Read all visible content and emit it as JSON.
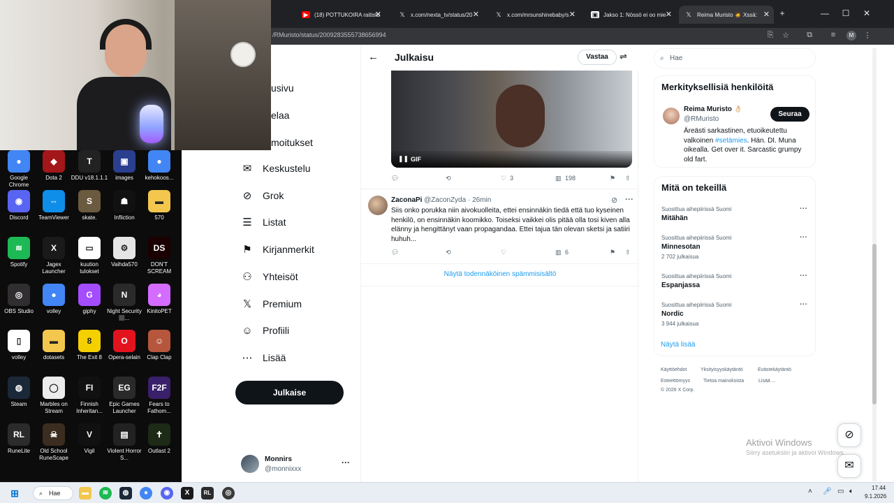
{
  "desktop": {
    "icons": [
      {
        "label": "Google Chrome",
        "color": "#4285f4",
        "glyph": "●"
      },
      {
        "label": "Dota 2",
        "color": "#a3161a",
        "glyph": "◆"
      },
      {
        "label": "DDU v18.1.1.1",
        "color": "#222",
        "glyph": "T"
      },
      {
        "label": "images",
        "color": "#2b3f8f",
        "glyph": "▣"
      },
      {
        "label": "kehokoos...",
        "color": "#4285f4",
        "glyph": "●"
      },
      {
        "label": "Discord",
        "color": "#5865f2",
        "glyph": "◉"
      },
      {
        "label": "TeamViewer",
        "color": "#0e8ee9",
        "glyph": "⇔"
      },
      {
        "label": "skate.",
        "color": "#6a5a3f",
        "glyph": "S"
      },
      {
        "label": "Infliction",
        "color": "#111",
        "glyph": "☗"
      },
      {
        "label": "570",
        "color": "#f3c74d",
        "glyph": "▬"
      },
      {
        "label": "Spotify",
        "color": "#1db954",
        "glyph": "≋"
      },
      {
        "label": "Jagex Launcher",
        "color": "#1a1a1a",
        "glyph": "X"
      },
      {
        "label": "kuution tulokset",
        "color": "#ffffff",
        "glyph": "▭"
      },
      {
        "label": "Vaihda570",
        "color": "#e5e5e5",
        "glyph": "⚙"
      },
      {
        "label": "DON'T SCREAM",
        "color": "#1a0000",
        "glyph": "DS"
      },
      {
        "label": "OBS Studio",
        "color": "#302e31",
        "glyph": "◎"
      },
      {
        "label": "volley",
        "color": "#4285f4",
        "glyph": "●"
      },
      {
        "label": "giphy",
        "color": "#a44dff",
        "glyph": "G"
      },
      {
        "label": "Night Security 🏽...",
        "color": "#2a2a2a",
        "glyph": "N"
      },
      {
        "label": "KinitoPET",
        "color": "#d46cff",
        "glyph": "◕"
      },
      {
        "label": "volley",
        "color": "#ffffff",
        "glyph": "▯"
      },
      {
        "label": "dotasets",
        "color": "#f3c74d",
        "glyph": "▬"
      },
      {
        "label": "The Exit 8",
        "color": "#f5d000",
        "glyph": "8"
      },
      {
        "label": "Opera-selain",
        "color": "#e3131e",
        "glyph": "O"
      },
      {
        "label": "Clap Clap",
        "color": "#b6563c",
        "glyph": "☺"
      },
      {
        "label": "Steam",
        "color": "#1b2838",
        "glyph": "◍"
      },
      {
        "label": "Marbles on Stream",
        "color": "#ececec",
        "glyph": "◯"
      },
      {
        "label": "Finnish Inheritan...",
        "color": "#111",
        "glyph": "FI"
      },
      {
        "label": "Epic Games Launcher",
        "color": "#2a2a2a",
        "glyph": "EG"
      },
      {
        "label": "Fears to Fathom...",
        "color": "#3a1f6a",
        "glyph": "F2F"
      },
      {
        "label": "RuneLite",
        "color": "#2b2b2b",
        "glyph": "RL"
      },
      {
        "label": "Old School RuneScape",
        "color": "#3b2d1f",
        "glyph": "☠"
      },
      {
        "label": "Vigil",
        "color": "#111",
        "glyph": "V"
      },
      {
        "label": "Violent Horror S...",
        "color": "#222",
        "glyph": "▤"
      },
      {
        "label": "Outlast 2",
        "color": "#1c2a16",
        "glyph": "✝"
      }
    ]
  },
  "browser": {
    "tabs": [
      {
        "label": "(18) POTTUKOIRA raitistu",
        "fav": "▶",
        "favcolor": "#ff0000"
      },
      {
        "label": "x.com/nexta_tv/status/20",
        "fav": "X",
        "favcolor": "#202124"
      },
      {
        "label": "x.com/mrsunshinebaby/s",
        "fav": "X",
        "favcolor": "#202124"
      },
      {
        "label": "Jakso 1: Nössö ei oo mie",
        "fav": "▣",
        "favcolor": "#ffffff"
      },
      {
        "label": "Reima Muristo 🧔 Xssä:",
        "fav": "X",
        "favcolor": "#202124"
      }
    ],
    "new_tab": "+",
    "url": "/RMuristo/status/2009283555738656994",
    "profile_letter": "M"
  },
  "x": {
    "nav": [
      {
        "label": "Etusivu",
        "icon": "⌂"
      },
      {
        "label": "Selaa",
        "icon": "⌕"
      },
      {
        "label": "Ilmoitukset",
        "icon": "🔔"
      },
      {
        "label": "Keskustelu",
        "icon": "✉"
      },
      {
        "label": "Grok",
        "icon": "⊘"
      },
      {
        "label": "Listat",
        "icon": "☰"
      },
      {
        "label": "Kirjanmerkit",
        "icon": "⚑"
      },
      {
        "label": "Yhteisöt",
        "icon": "⚇"
      },
      {
        "label": "Premium",
        "icon": "𝕏"
      },
      {
        "label": "Profiili",
        "icon": "☺"
      },
      {
        "label": "Lisää",
        "icon": "⋯"
      }
    ],
    "visible_nav": [
      "usivu",
      "elaa",
      "moitukset"
    ],
    "post_button": "Julkaise",
    "account": {
      "name": "Monnirs",
      "handle": "@monnixxx",
      "more": "···"
    },
    "header": {
      "title": "Julkaisu",
      "reply": "Vastaa"
    },
    "gif_label": "GIF",
    "tweet1_actions": {
      "likes": "3",
      "views": "198"
    },
    "tweet2": {
      "name": "ZaconaPi",
      "handle": "@ZaconZyda · 26min",
      "text": "Siis onko porukka niin aivokuolleita, ettei ensinnäkin tiedä että tuo kyseinen henkilö, on ensinnäkin koomikko. Toiseksi vaikkei olis pitää olla tosi kiven alla elänny ja hengittänyt vaan propagandaa. Ettei tajua tän olevan sketsi ja satiiri huhuh...",
      "views": "6"
    },
    "spam_link": "Näytä todennäköinen spämmisisältö",
    "search_placeholder": "Hae",
    "relevant": {
      "title": "Merkityksellisiä henkilöitä",
      "name": "Reima Muristo 👌🏻",
      "handle": "@RMuristo",
      "follow": "Seuraa",
      "bio_a": "Äreästi sarkastinen, etuoikeutettu valkoinen ",
      "bio_tag": "#setämies",
      "bio_b": ". Hän. DI. Muna oikealla. Get over it. Sarcastic grumpy old fart."
    },
    "trends": {
      "title": "Mitä on tekeillä",
      "items": [
        {
          "meta": "Suosittua aihepiirissä Suomi",
          "name": "Mitähän",
          "count": ""
        },
        {
          "meta": "Suosittua aihepiirissä Suomi",
          "name": "Minnesotan",
          "count": "2 702 julkaisua"
        },
        {
          "meta": "Suosittua aihepiirissä Suomi",
          "name": "Espanjassa",
          "count": ""
        },
        {
          "meta": "Suosittua aihepiirissä Suomi",
          "name": "Nordic",
          "count": "3 944 julkaisua"
        }
      ],
      "show_more": "Näytä lisää"
    },
    "footer": {
      "l1": "Käyttöehdot",
      "l2": "Yksityisyyskäytäntö",
      "l3": "Evästekäytäntö",
      "l4": "Esteettömyys",
      "l5": "Tietoa mainoksista",
      "l6": "Lisää ...",
      "copy": "© 2026 X Corp."
    }
  },
  "watermark": {
    "line1": "Aktivoi Windows",
    "line2": "Siirry asetuksiin ja aktivoi Windows."
  },
  "taskbar": {
    "search": "Hae",
    "time": "17.44",
    "date": "9.1.2026"
  }
}
